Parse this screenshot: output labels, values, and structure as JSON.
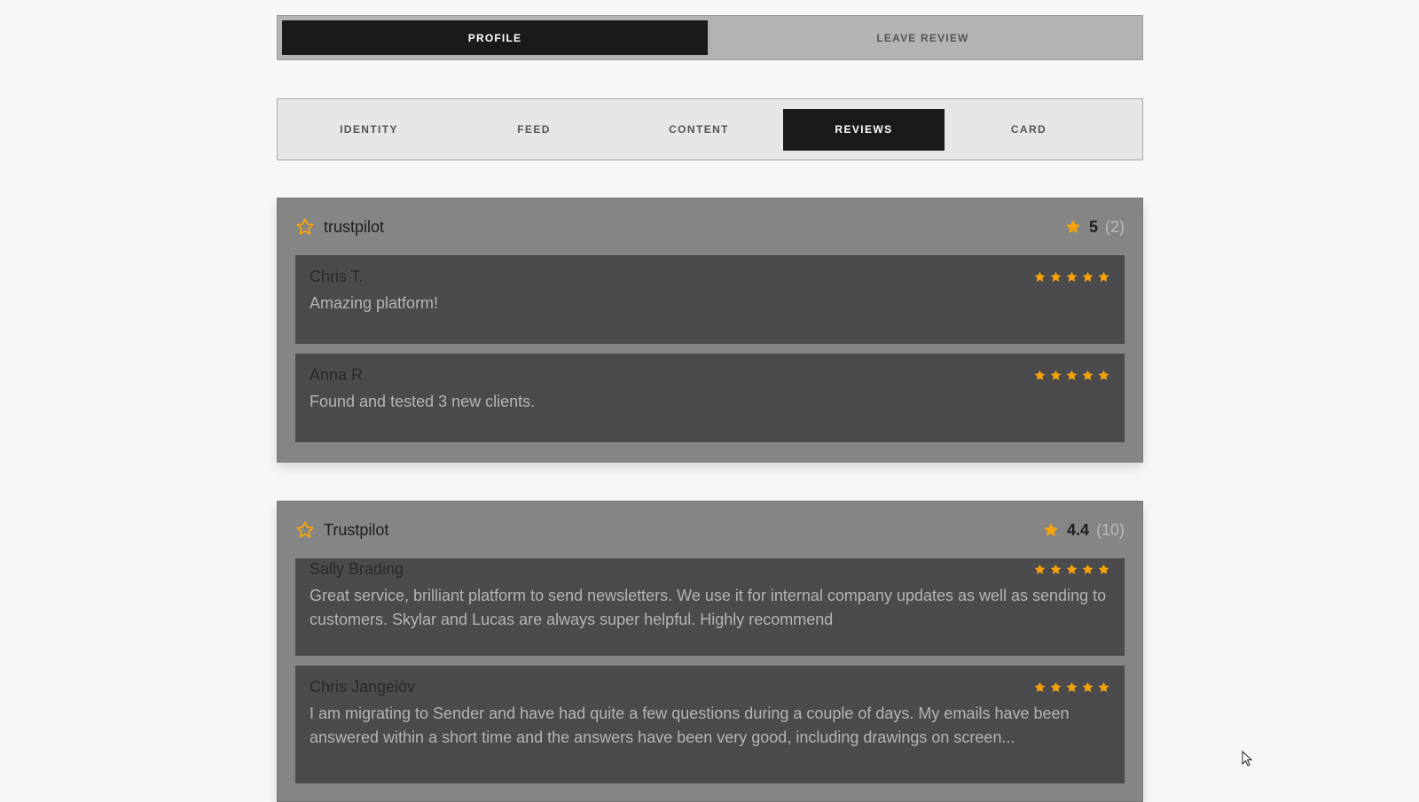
{
  "top_tabs": [
    {
      "label": "PROFILE",
      "active": true
    },
    {
      "label": "LEAVE REVIEW",
      "active": false
    }
  ],
  "sub_tabs": [
    {
      "label": "IDENTITY",
      "active": false
    },
    {
      "label": "FEED",
      "active": false
    },
    {
      "label": "CONTENT",
      "active": false
    },
    {
      "label": "REVIEWS",
      "active": true
    },
    {
      "label": "CARD",
      "active": false
    }
  ],
  "cards": [
    {
      "provider": "trustpilot",
      "rating": "5",
      "count": "(2)",
      "reviews": [
        {
          "name": "Chris T.",
          "text": "Amazing platform!",
          "stars": 5
        },
        {
          "name": "Anna R.",
          "text": "Found and tested 3 new clients.",
          "stars": 5
        }
      ]
    },
    {
      "provider": "Trustpilot",
      "rating": "4.4",
      "count": "(10)",
      "reviews": [
        {
          "name": "Sally Brading",
          "text": "Great service, brilliant platform to send newsletters. We use it for internal company updates as well as sending to customers. Skylar and Lucas are always super helpful. Highly recommend",
          "stars": 5
        },
        {
          "name": "Chris Jangelöv",
          "text": "I am migrating to Sender and have had quite a few questions during a couple of days. My emails have been answered within a short time and the answers have been very good, including drawings on screen...",
          "stars": 5
        }
      ]
    }
  ],
  "colors": {
    "accent_star": "#f5a30a",
    "active_tab": "#1a1a1a"
  },
  "icons": {
    "provider_icon": "star-outline-icon",
    "rating_icon": "star-filled-icon"
  }
}
